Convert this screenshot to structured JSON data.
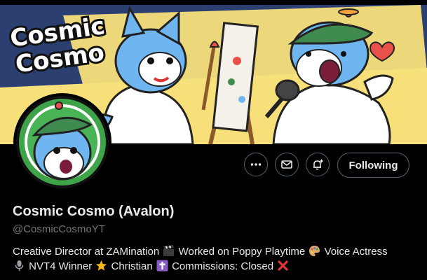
{
  "banner": {
    "logo_line1": "Cosmic",
    "logo_line2": "Cosmo",
    "colors": {
      "background": "#2b3f70",
      "stripe": "#f7e07a",
      "character_blue": "#6fb6f0",
      "cap_green": "#3f8b4f",
      "heart": "#e8524a"
    }
  },
  "actions": {
    "more_icon": "more-icon",
    "message_icon": "envelope-icon",
    "notify_icon": "bell-plus-icon",
    "follow_label": "Following"
  },
  "profile": {
    "display_name": "Cosmic Cosmo (Avalon)",
    "handle": "@CosmicCosmoYT",
    "bio_parts": {
      "p1": "Creative Director at ZAMination",
      "p2": "Worked on Poppy Playtime",
      "p3": "Voice Actress",
      "p4": "NVT4 Winner",
      "p5": "Christian",
      "p6": "Commissions: Closed"
    },
    "bio_emoji": [
      "clapper-board-icon",
      "artist-palette-icon",
      "microphone-icon",
      "star-icon",
      "latin-cross-icon",
      "cross-mark-icon"
    ]
  },
  "colors": {
    "page_bg": "#000000",
    "text_primary": "#e7e9ea",
    "text_secondary": "#71767b",
    "border": "#536471"
  }
}
